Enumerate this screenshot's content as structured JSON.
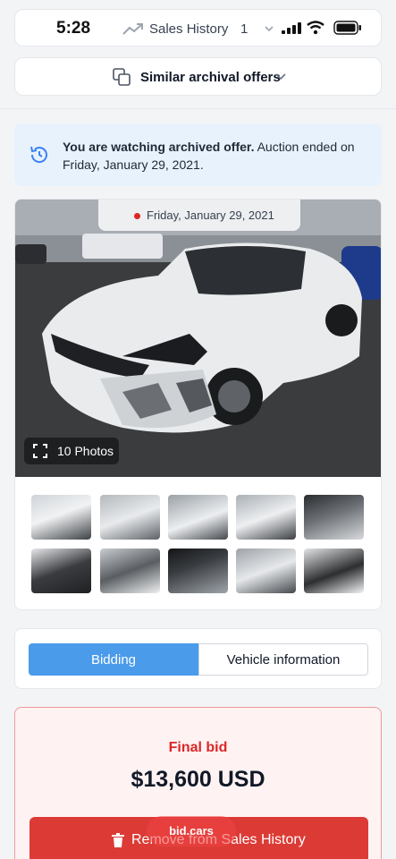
{
  "status_bar": {
    "time": "5:28",
    "sales_history_label": "Sales History",
    "sales_history_count": "1",
    "icons": [
      "trend-icon",
      "chevron-down-icon",
      "signal-icon",
      "wifi-icon",
      "battery-icon"
    ]
  },
  "similar_offers": {
    "label": "Similar archival offers",
    "icon": "copy-icon"
  },
  "notice": {
    "bold_text": "You are watching archived offer.",
    "text": " Auction ended on Friday, January 29, 2021.",
    "icon": "history-icon"
  },
  "gallery": {
    "date_label": "Friday, January 29, 2021",
    "photos_label": "10 Photos",
    "thumbnail_count": 10
  },
  "tabs": {
    "bidding": "Bidding",
    "vehicle_information": "Vehicle information",
    "active": "bidding"
  },
  "bid": {
    "final_label": "Final bid",
    "final_value": "$13,600 USD",
    "remove_button_label": "Remove from Sales History"
  },
  "watermark": "bid.cars",
  "colors": {
    "accent": "#4a9bea",
    "danger": "#dc3b35",
    "notice_bg": "#e8f2fc"
  }
}
